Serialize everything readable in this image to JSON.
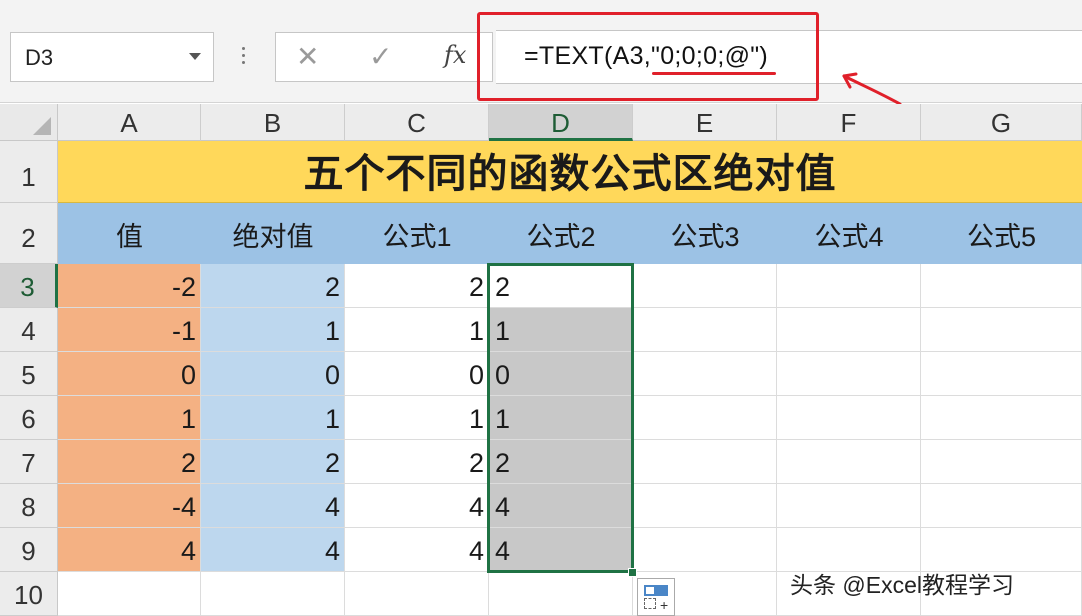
{
  "name_box": {
    "value": "D3"
  },
  "formula_bar": {
    "cancel_glyph": "✕",
    "enter_glyph": "✓",
    "fx_glyph": "fx",
    "formula": "=TEXT(A3,\"0;0;0;@\")"
  },
  "columns": [
    "A",
    "B",
    "C",
    "D",
    "E",
    "F",
    "G"
  ],
  "rows": [
    "1",
    "2",
    "3",
    "4",
    "5",
    "6",
    "7",
    "8",
    "9",
    "10"
  ],
  "title": "五个不同的函数公式区绝对值",
  "headers": [
    "值",
    "绝对值",
    "公式1",
    "公式2",
    "公式3",
    "公式4",
    "公式5"
  ],
  "data": {
    "values": [
      "-2",
      "-1",
      "0",
      "1",
      "2",
      "-4",
      "4"
    ],
    "abs_values": [
      "2",
      "1",
      "0",
      "1",
      "2",
      "4",
      "4"
    ],
    "formula1": [
      "2",
      "1",
      "0",
      "1",
      "2",
      "4",
      "4"
    ],
    "formula2": [
      "2",
      "1",
      "0",
      "1",
      "2",
      "4",
      "4"
    ]
  },
  "selected_cell": "D3",
  "colors": {
    "title_fill": "#ffd85a",
    "header_fill": "#9cc2e5",
    "value_fill": "#f4b183",
    "abs_fill": "#bdd7ee",
    "selection_fill": "#c8c8c8",
    "selection_border": "#1f7244",
    "annotation_red": "#e0202a"
  },
  "watermark": "头条 @Excel教程学习"
}
